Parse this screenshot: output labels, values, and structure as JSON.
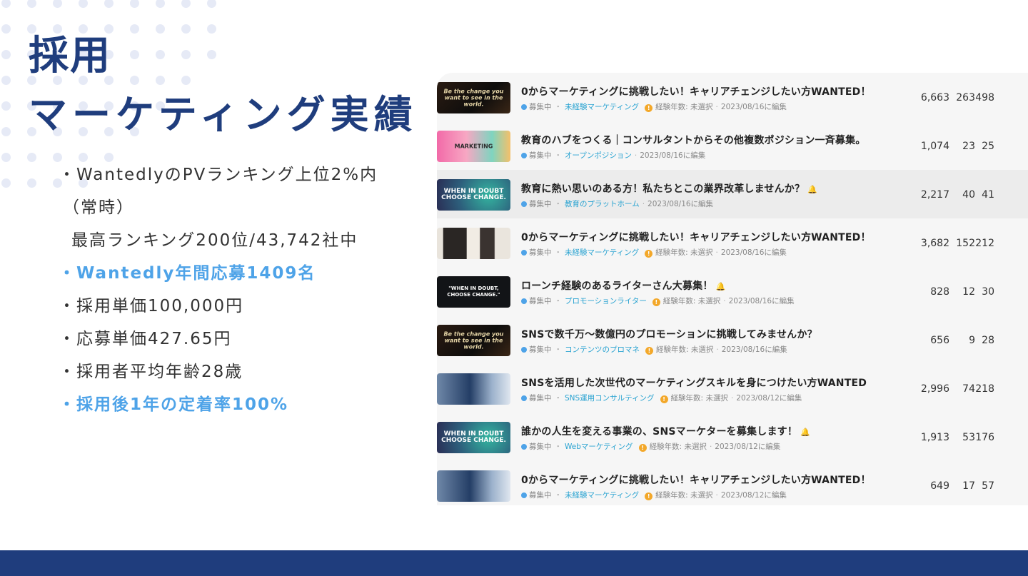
{
  "title_line1": "採用",
  "title_line2": "マーケティング実績",
  "bullets": [
    "・WantedlyのPVランキング上位2%内",
    "（常時）",
    "最高ランキング200位/43,742社中",
    "・Wantedly年間応募1409名",
    "・採用単価100,000円",
    "・応募単価427.65円",
    "・採用者平均年齢28歳",
    "・採用後1年の定着率100%"
  ],
  "status_label": "募集中",
  "experience_label": "経験年数: 未選択",
  "jobs": [
    {
      "title": "0からマーケティングに挑戦したい！キャリアチェンジしたい方WANTED！",
      "category": "未経験マーケティング",
      "date": "2023/08/16に編集",
      "stats": [
        "6,663",
        "263",
        "498"
      ],
      "thumb_text": "Be the change you want to see in the world."
    },
    {
      "title": "教育のハブをつくる｜コンサルタントからその他複数ポジション一斉募集。",
      "category": "オープンポジション",
      "date": "2023/08/16に編集",
      "stats": [
        "1,074",
        "23",
        "25"
      ],
      "thumb_text": "MARKETING"
    },
    {
      "title": "教育に熱い思いのある方！私たちとこの業界改革しませんか？",
      "category": "教育のプラットホーム",
      "date": "2023/08/16に編集",
      "stats": [
        "2,217",
        "40",
        "41"
      ],
      "thumb_text": "WHEN IN DOUBT CHOOSE CHANGE."
    },
    {
      "title": "0からマーケティングに挑戦したい！キャリアチェンジしたい方WANTED！",
      "category": "未経験マーケティング",
      "date": "2023/08/16に編集",
      "stats": [
        "3,682",
        "152",
        "212"
      ],
      "thumb_text": ""
    },
    {
      "title": "ローンチ経験のあるライターさん大募集！",
      "category": "プロモーションライター",
      "date": "2023/08/16に編集",
      "stats": [
        "828",
        "12",
        "30"
      ],
      "thumb_text": "\"WHEN IN DOUBT, CHOOSE CHANGE.\""
    },
    {
      "title": "SNSで数千万～数億円のプロモーションに挑戦してみませんか？",
      "category": "コンテンツのプロマネ",
      "date": "2023/08/16に編集",
      "stats": [
        "656",
        "9",
        "28"
      ],
      "thumb_text": "Be the change you want to see in the world."
    },
    {
      "title": "SNSを活用した次世代のマーケティングスキルを身につけたい方WANTED",
      "category": "SNS運用コンサルティング",
      "date": "2023/08/12に編集",
      "stats": [
        "2,996",
        "74",
        "218"
      ],
      "thumb_text": ""
    },
    {
      "title": "誰かの人生を変える事業の、SNSマーケターを募集します！",
      "category": "Webマーケティング",
      "date": "2023/08/12に編集",
      "stats": [
        "1,913",
        "53",
        "176"
      ],
      "thumb_text": "WHEN IN DOUBT CHOOSE CHANGE."
    },
    {
      "title": "0からマーケティングに挑戦したい！キャリアチェンジしたい方WANTED！",
      "category": "未経験マーケティング",
      "date": "2023/08/12に編集",
      "stats": [
        "649",
        "17",
        "57"
      ],
      "thumb_text": ""
    }
  ]
}
